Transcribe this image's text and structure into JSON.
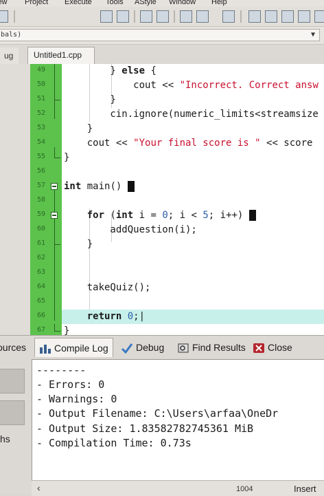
{
  "menu": [
    "iew",
    "Project",
    "Execute",
    "Tools",
    "AStyle",
    "Window",
    "Help"
  ],
  "combo": {
    "value": "bals)"
  },
  "tabs": {
    "left_tab": "ug",
    "file_tab": "Untitled1.cpp"
  },
  "editor": {
    "lines": [
      {
        "n": "49",
        "text": "        } else {"
      },
      {
        "n": "50",
        "text": "            cout << \"Incorrect. Correct answ"
      },
      {
        "n": "51",
        "text": "        }"
      },
      {
        "n": "52",
        "text": "        cin.ignore(numeric_limits<streamsize"
      },
      {
        "n": "53",
        "text": "    }"
      },
      {
        "n": "54",
        "text": "    cout << \"Your final score is \" << score"
      },
      {
        "n": "55",
        "text": "}"
      },
      {
        "n": "56",
        "text": ""
      },
      {
        "n": "57",
        "text": "int main()"
      },
      {
        "n": "58",
        "text": ""
      },
      {
        "n": "59",
        "text": "    for (int i = 0; i < 5; i++)"
      },
      {
        "n": "60",
        "text": "        addQuestion(i);"
      },
      {
        "n": "61",
        "text": "    }"
      },
      {
        "n": "62",
        "text": ""
      },
      {
        "n": "63",
        "text": ""
      },
      {
        "n": "64",
        "text": "    takeQuiz();"
      },
      {
        "n": "65",
        "text": ""
      },
      {
        "n": "66",
        "text": "    return 0;"
      },
      {
        "n": "67",
        "text": "}"
      }
    ]
  },
  "bottom_tabs": {
    "sources": "ources",
    "compile_log": "Compile Log",
    "debug": "Debug",
    "find_results": "Find Results",
    "close": "Close"
  },
  "left_bottom_label": "hs",
  "compile_log": {
    "separator": "--------",
    "errors": "- Errors: 0",
    "warnings": "- Warnings: 0",
    "output_filename": "- Output Filename: C:\\Users\\arfaa\\OneDr",
    "output_size": "- Output Size: 1.83582782745361 MiB",
    "compilation_time": "- Compilation Time: 0.73s"
  },
  "status": {
    "line_count": "1004",
    "mode": "Insert"
  },
  "colors": {
    "gutter": "#5cc24c",
    "string": "#c8102e",
    "number": "#2d5fa8",
    "current_line": "#c8f0ea"
  },
  "icons": [
    "new-file-icon",
    "open-icon",
    "save-icon",
    "compile-icon",
    "run-icon",
    "window-icon",
    "compile-log-icon",
    "debug-check-icon",
    "find-results-icon",
    "close-icon"
  ]
}
